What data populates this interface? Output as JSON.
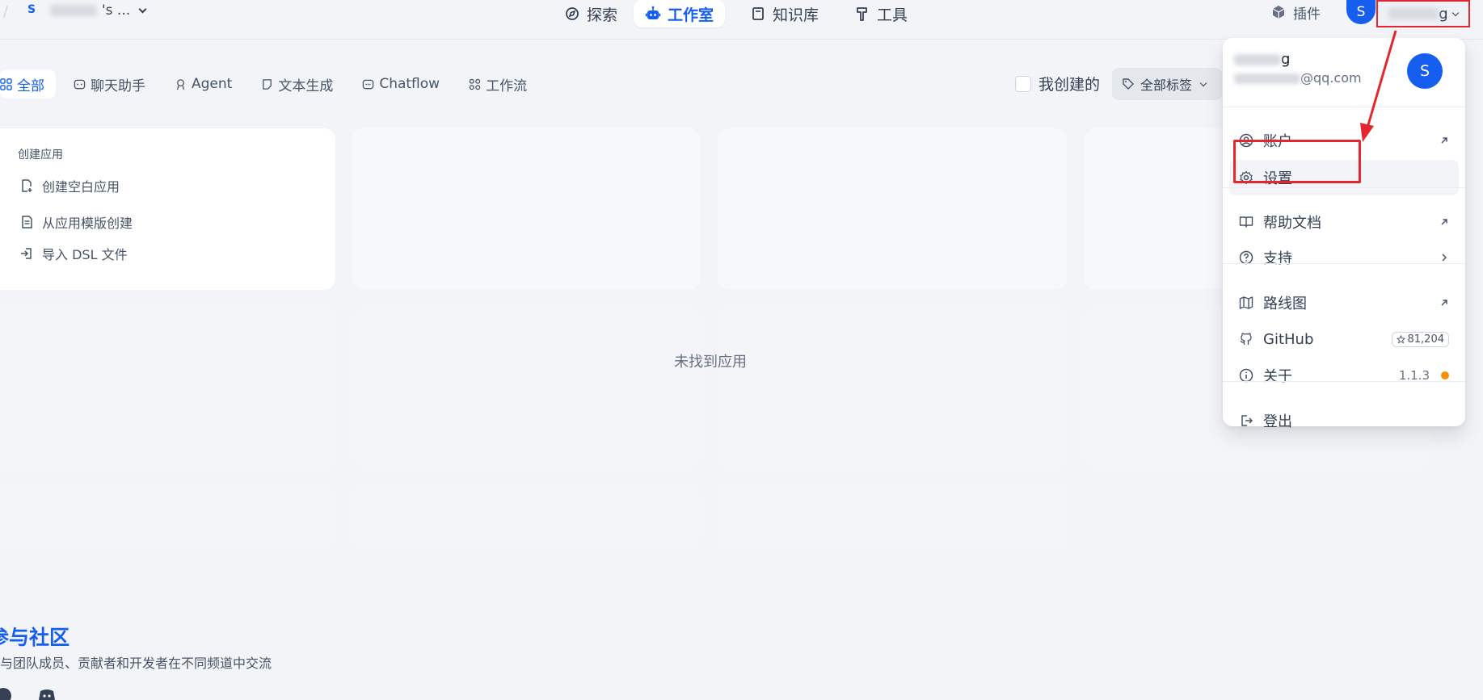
{
  "workspace": {
    "avatar_letter": "S",
    "name_suffix": "'s ..."
  },
  "nav": {
    "items": [
      {
        "label": "探索",
        "icon": "compass-icon"
      },
      {
        "label": "工作室",
        "icon": "robot-icon",
        "active": true
      },
      {
        "label": "知识库",
        "icon": "book-icon"
      },
      {
        "label": "工具",
        "icon": "hammer-icon"
      }
    ],
    "plugin_label": "插件"
  },
  "user": {
    "avatar_letter": "S",
    "name_visible_end": "g"
  },
  "filters": {
    "tabs": [
      {
        "label": "全部",
        "active": true
      },
      {
        "label": "聊天助手"
      },
      {
        "label": "Agent"
      },
      {
        "label": "文本生成"
      },
      {
        "label": "Chatflow"
      },
      {
        "label": "工作流"
      }
    ],
    "mine_label": "我创建的",
    "tags_label": "全部标签"
  },
  "create_card": {
    "title": "创建应用",
    "items": [
      "创建空白应用",
      "从应用模版创建",
      "导入 DSL 文件"
    ]
  },
  "empty_text": "未找到应用",
  "community": {
    "title": "参与社区",
    "subtitle": "与团队成员、贡献者和开发者在不同频道中交流"
  },
  "dropdown": {
    "name_visible_end": "g",
    "email_visible": "@qq.com",
    "avatar_letter": "S",
    "items": {
      "account": "账户",
      "settings": "设置",
      "help": "帮助文档",
      "support": "支持",
      "roadmap": "路线图",
      "github": "GitHub",
      "github_stars": "81,204",
      "about": "关于",
      "version": "1.1.3",
      "logout": "登出"
    }
  },
  "colors": {
    "accent": "#155eef",
    "annotation": "#e3262f",
    "version_dot": "#f79009"
  }
}
